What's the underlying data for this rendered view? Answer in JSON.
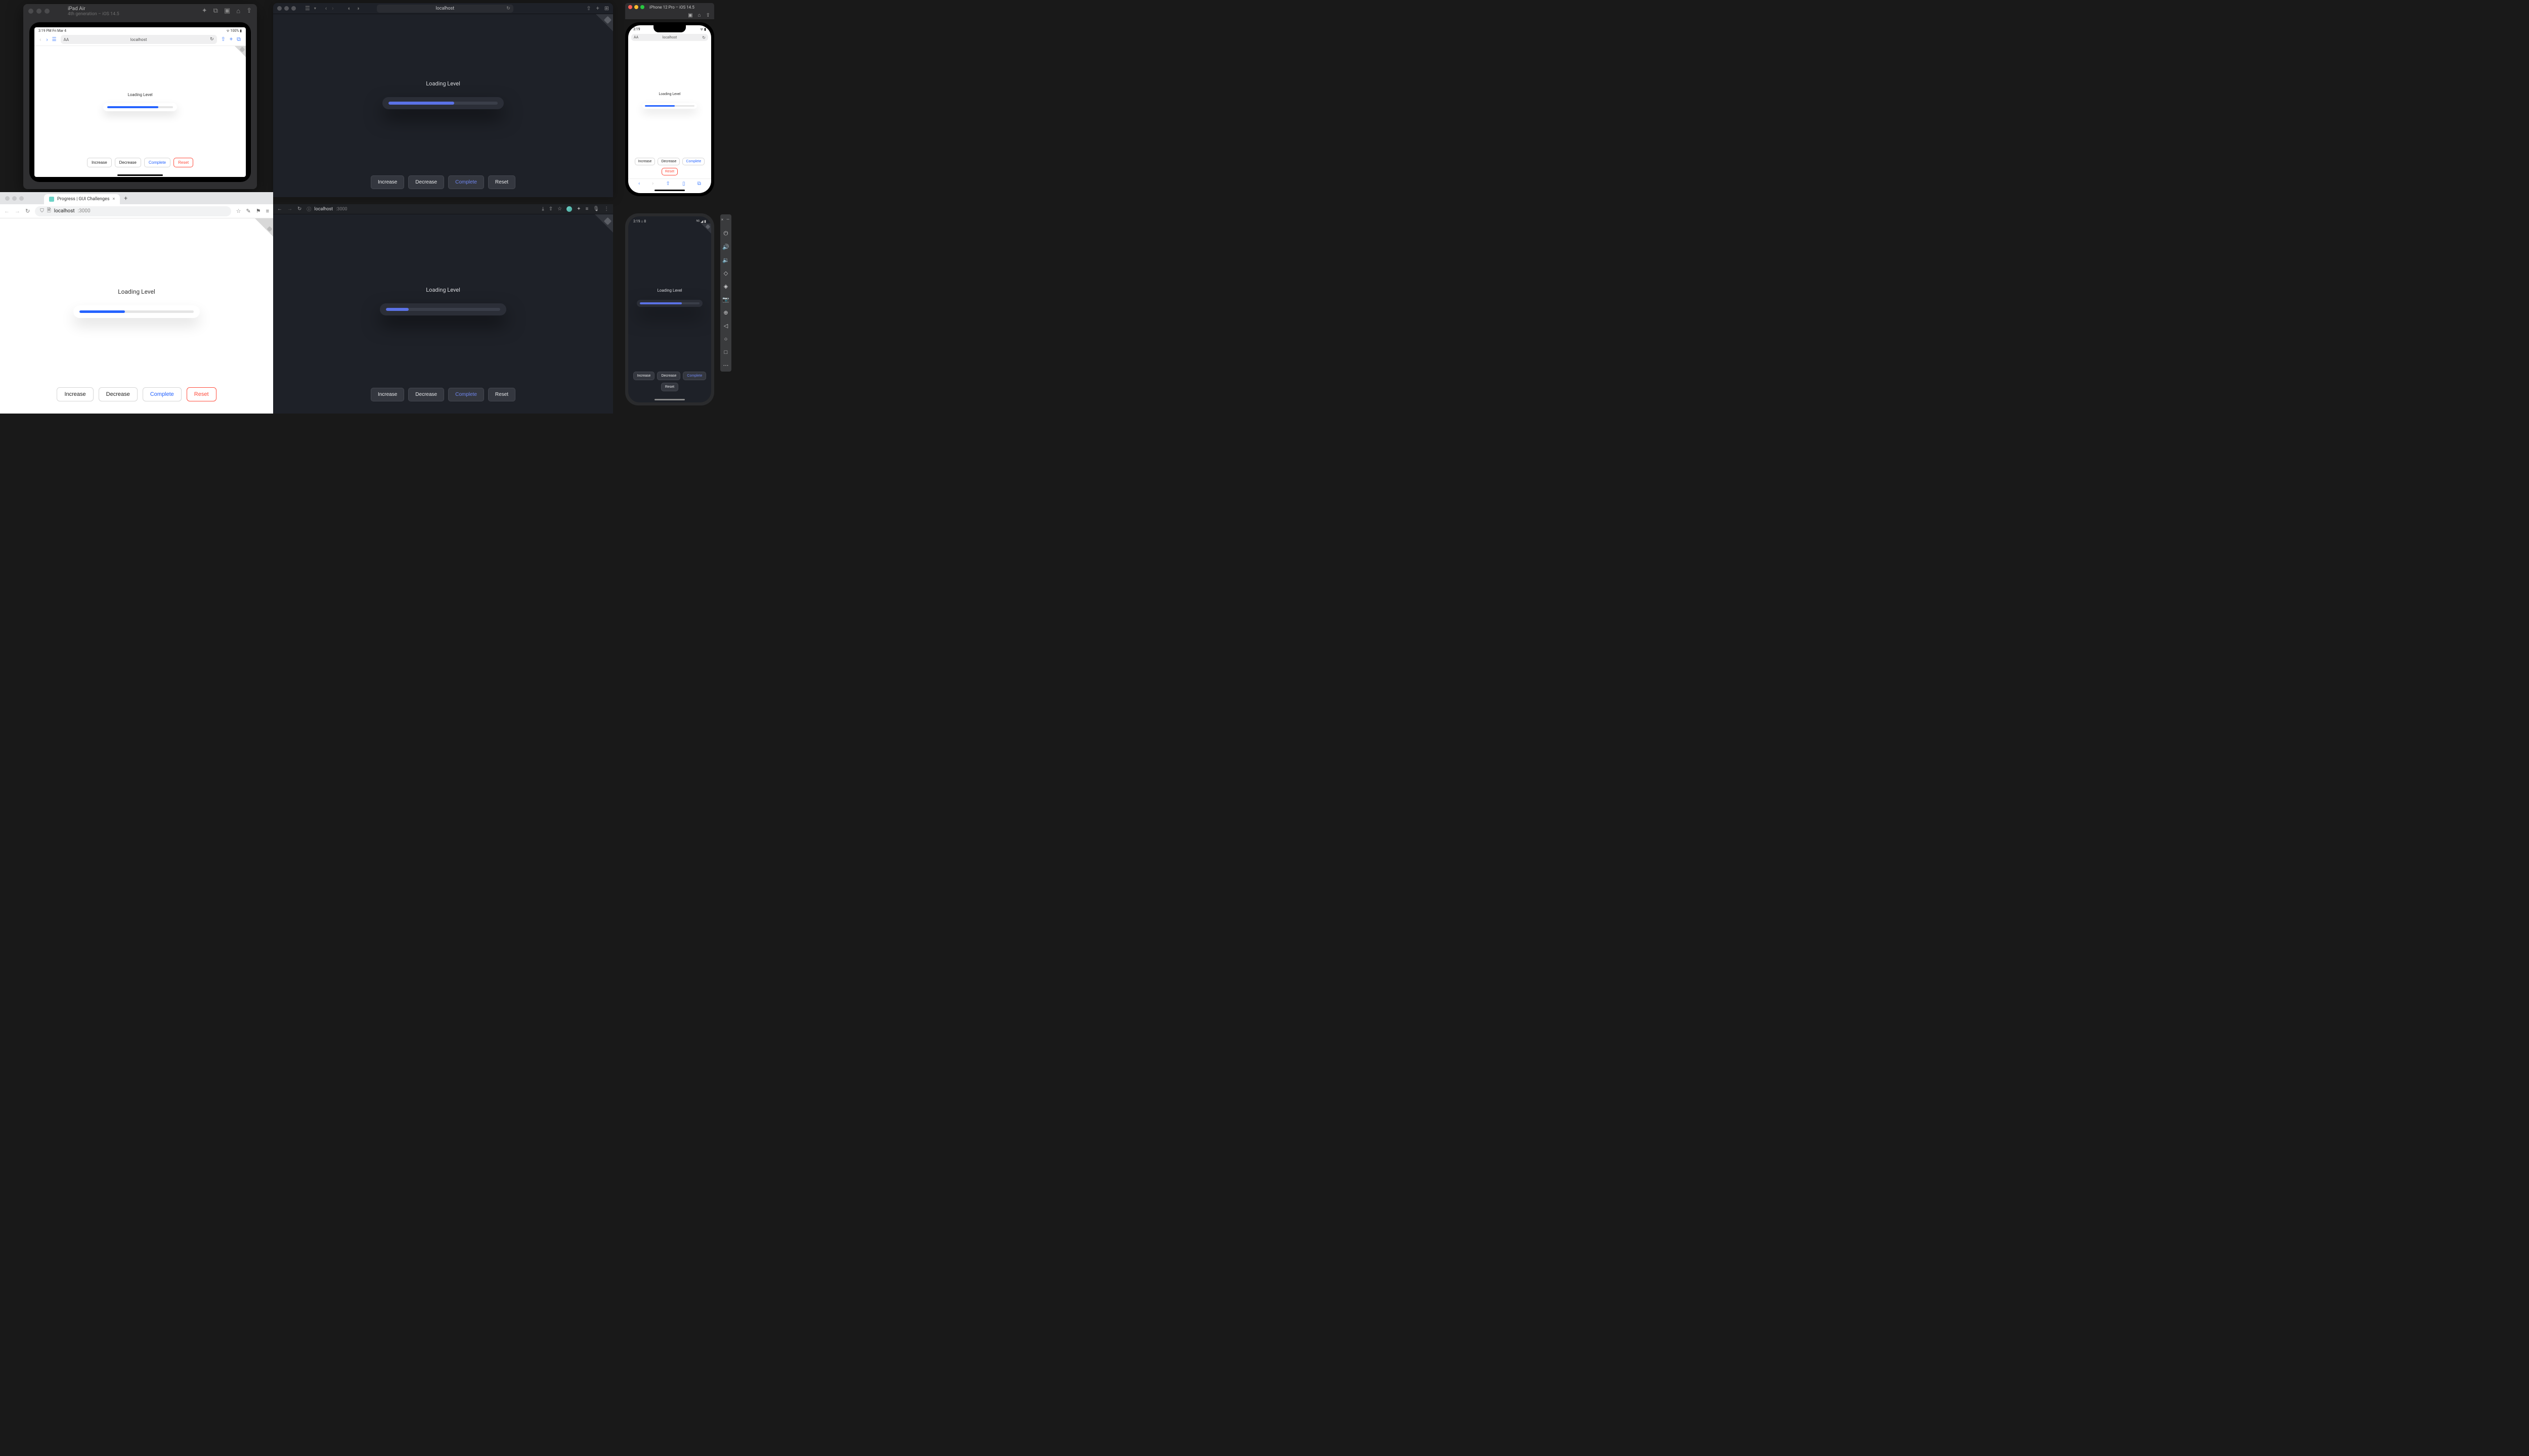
{
  "app": {
    "loading_label": "Loading Level",
    "buttons": {
      "increase": "Increase",
      "decrease": "Decrease",
      "complete": "Complete",
      "reset": "Reset"
    }
  },
  "colors": {
    "progress_light": "#2563ff",
    "progress_dark": "#5b72e6",
    "complete_blue": "#2563ff",
    "reset_red": "#ff4d3d"
  },
  "ipad_sim": {
    "title": "iPad Air",
    "subtitle": "4th generation – iOS 14.5",
    "status_left": "3:19 PM  Fri Mar 4",
    "status_right": "100%",
    "url": "localhost",
    "progress_percent": 78
  },
  "safari_dark": {
    "url": "localhost",
    "progress_percent": 60
  },
  "iphone_sim": {
    "title": "iPhone 12 Pro – iOS 14.5",
    "status_time": "3:19",
    "url": "localhost",
    "progress_percent": 60
  },
  "chrome_light": {
    "tab_title": "Progress | GUI Challenges",
    "url_host": "localhost",
    "url_port": ":3000",
    "progress_percent": 40
  },
  "chrome_dark": {
    "url_host": "localhost",
    "url_port": ":3000",
    "progress_percent": 20
  },
  "android": {
    "status_time": "3:19",
    "status_icon_label": "8",
    "progress_percent": 70
  }
}
